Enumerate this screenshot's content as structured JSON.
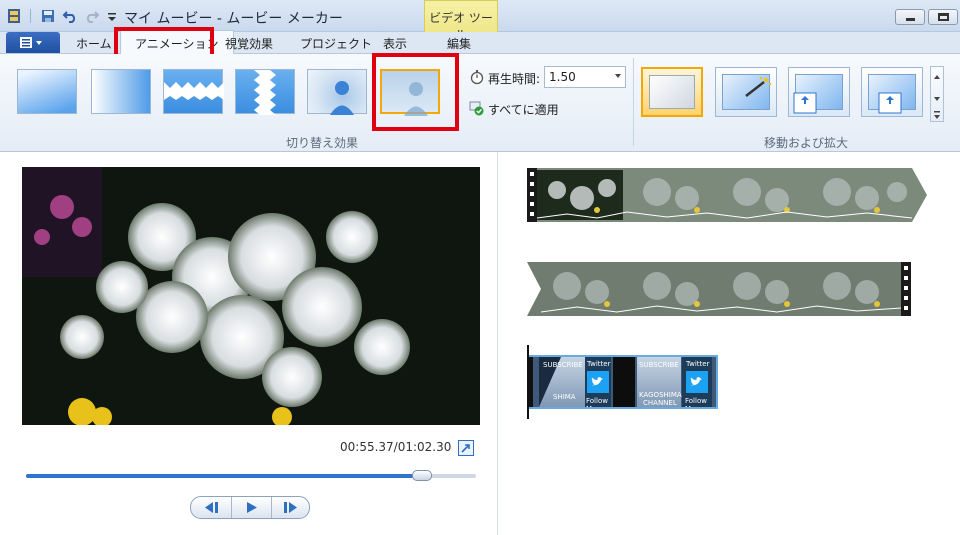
{
  "titlebar": {
    "title": "マイ ムービー - ムービー メーカー",
    "context_group": "ビデオ ツール"
  },
  "tabs": {
    "home": "ホーム",
    "animation": "アニメーション",
    "visual_effects": "視覚効果",
    "project": "プロジェクト",
    "view": "表示",
    "edit": "編集"
  },
  "ribbon": {
    "transitions_group": "切り替え効果",
    "duration_label": "再生時間:",
    "duration_value": "1.50",
    "apply_all": "すべてに適用",
    "pan_zoom_group": "移動および拡大"
  },
  "player": {
    "time": "00:55.37/01:02.30",
    "seek_fraction": 0.89
  },
  "storyboard": {
    "clip3_labels": {
      "subscribe1": "SUBSCRIBE",
      "twitter1": "Twitter",
      "follow1": "Follow Me",
      "shima": "SHIMA",
      "subscribe2": "SUBSCRIBE",
      "twitter2": "Twitter",
      "kagoshima": "KAGOSHIMA",
      "channel": "CHANNEL",
      "follow2": "Follow Me"
    }
  },
  "colors": {
    "highlight": "#e0000f",
    "selection": "#f0a80a",
    "accent": "#2f74cf"
  }
}
